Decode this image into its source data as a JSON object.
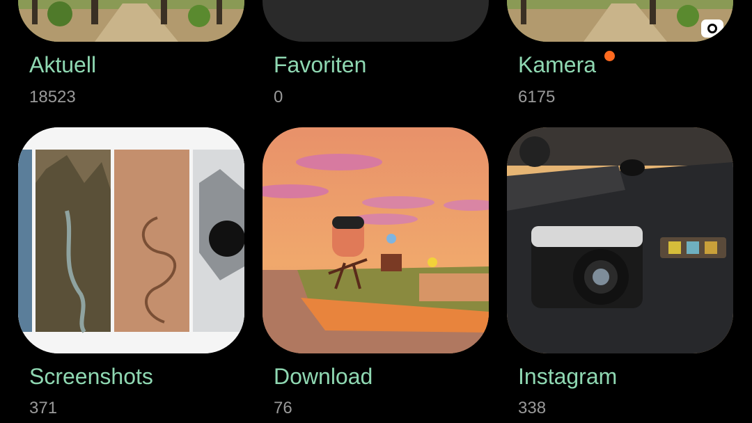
{
  "albums": [
    {
      "name": "Aktuell",
      "count": "18523",
      "thumb": "forest-path"
    },
    {
      "name": "Favoriten",
      "count": "0",
      "thumb": "empty"
    },
    {
      "name": "Kamera",
      "count": "6175",
      "thumb": "forest-path",
      "badge": "new-indicator-dot",
      "overlay_icon": "camera-icon"
    },
    {
      "name": "Screenshots",
      "count": "371",
      "thumb": "satellite-wallpapers"
    },
    {
      "name": "Download",
      "count": "76",
      "thumb": "game-island-sunset"
    },
    {
      "name": "Instagram",
      "count": "338",
      "thumb": "lego-camera-desk"
    }
  ],
  "colors": {
    "title": "#8fd8b2",
    "count": "#9a9a9a",
    "background": "#000000",
    "badge": "#ff6a1f"
  }
}
